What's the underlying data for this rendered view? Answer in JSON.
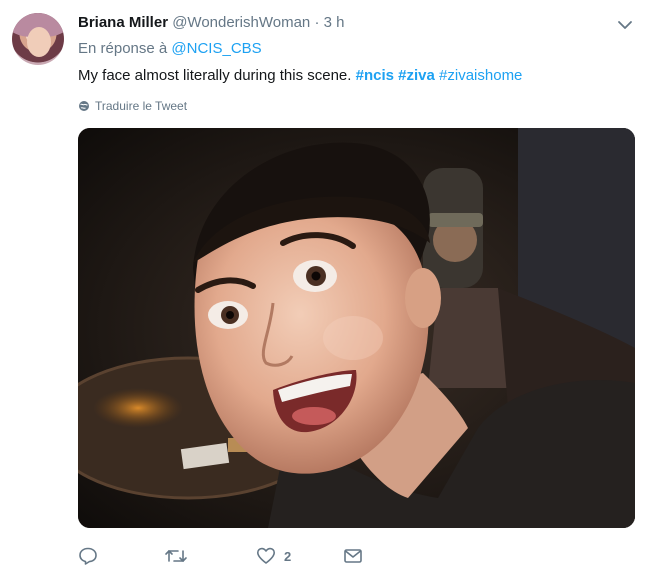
{
  "tweet": {
    "author": {
      "name": "Briana Miller",
      "handle": "@WonderishWoman",
      "separator": "·",
      "time": "3 h"
    },
    "reply": {
      "prefix": "En réponse à",
      "mention": "@NCIS_CBS"
    },
    "text": {
      "body": "My face almost literally during this scene. ",
      "hashtags": [
        "#ncis",
        "#ziva",
        "#zivaishome"
      ]
    },
    "translate_label": "Traduire le Tweet",
    "actions": {
      "reply_icon": "reply-icon",
      "retweet_icon": "retweet-icon",
      "like_icon": "heart-icon",
      "like_count": "2",
      "dm_icon": "mail-icon"
    },
    "colors": {
      "link": "#1da1f2",
      "muted": "#657786",
      "text": "#14171a"
    }
  }
}
